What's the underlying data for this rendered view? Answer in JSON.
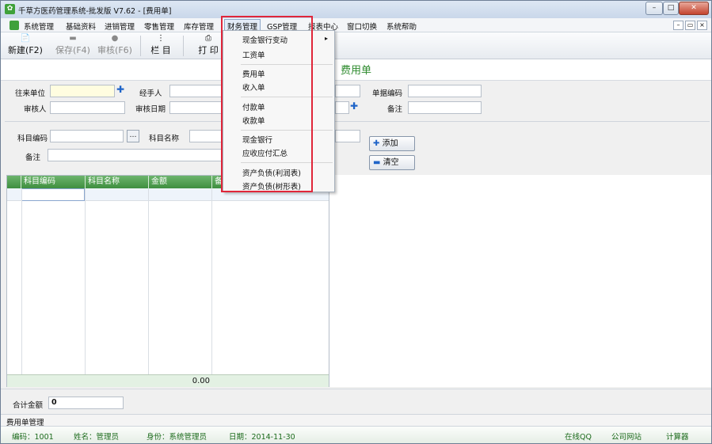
{
  "window": {
    "title": "千草方医药管理系统-批发版 V7.62 - [费用单]",
    "icon": "app-leaf-icon"
  },
  "menubar": {
    "items": [
      "系统管理",
      "基础资料",
      "进销管理",
      "零售管理",
      "库存管理",
      "财务管理",
      "GSP管理",
      "报表中心",
      "窗口切换",
      "系统帮助"
    ],
    "active": "财务管理"
  },
  "toolbar": {
    "new": "新建(F2)",
    "save": "保存(F4)",
    "audit": "审核(F6)",
    "columns": "栏 目",
    "print": "打 印"
  },
  "doc": {
    "title": "费用单"
  },
  "form": {
    "partner_label": "往来单位",
    "handler_label": "经手人",
    "source_label": "单据编码",
    "reviewer_label": "审核人",
    "review_date_label": "审核日期",
    "remark_label": "备注",
    "subject_code_label": "科目编码",
    "subject_name_label": "科目名称",
    "note_label": "备注",
    "add_button": "添加",
    "clear_button": "清空"
  },
  "table": {
    "columns": [
      "科目编码",
      "科目名称",
      "金额",
      "备"
    ],
    "total": "0.00"
  },
  "summary": {
    "total_label": "合计金额",
    "total_value": "0"
  },
  "status": {
    "module": "费用单管理",
    "code": "编码：1001",
    "name": "姓名：管理员",
    "role": "身份：系统管理员",
    "date": "日期：2014-11-30",
    "links": [
      "在线QQ",
      "公司网站",
      "计算器"
    ]
  },
  "finance_menu": {
    "items": [
      "现金银行变动",
      "工资单",
      "费用单",
      "收入单",
      "付款单",
      "收款单",
      "现金银行",
      "应收应付汇总",
      "资产负债(利润表)",
      "资产负债(树形表)"
    ]
  },
  "colors": {
    "accent_green": "#3f8f3f",
    "highlight_red": "#e0263a"
  }
}
